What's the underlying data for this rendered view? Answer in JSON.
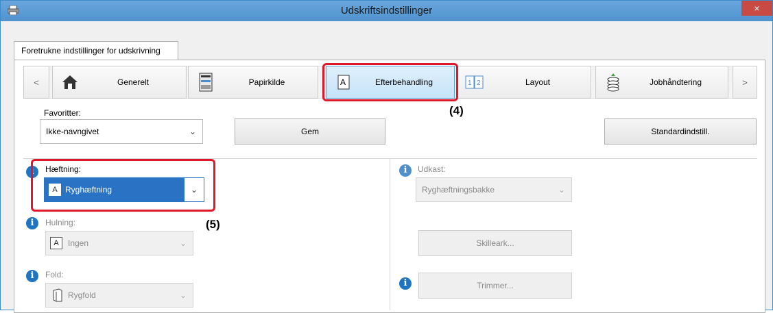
{
  "window": {
    "title": "Udskriftsindstillinger",
    "close_label": "×"
  },
  "tab": {
    "label": "Foretrukne indstillinger for udskrivning"
  },
  "nav": {
    "prev": "<",
    "next": ">",
    "items": [
      {
        "label": "Generelt",
        "icon": "home-icon"
      },
      {
        "label": "Papirkilde",
        "icon": "printer-tray-icon"
      },
      {
        "label": "Efterbehandling",
        "icon": "finishing-page-icon"
      },
      {
        "label": "Layout",
        "icon": "layout-pages-icon"
      },
      {
        "label": "Jobhåndtering",
        "icon": "job-stack-icon"
      }
    ]
  },
  "favorites": {
    "label": "Favoritter:",
    "value": "Ikke-navngivet",
    "save_label": "Gem",
    "defaults_label": "Standardindstill."
  },
  "stapling": {
    "label": "Hæftning:",
    "value": "Ryghæftning",
    "icon_glyph": "A"
  },
  "punch": {
    "label": "Hulning:",
    "value": "Ingen",
    "icon_glyph": "A"
  },
  "fold": {
    "label": "Fold:",
    "value": "Rygfold"
  },
  "output": {
    "label": "Udkast:",
    "value": "Ryghæftningsbakke"
  },
  "separator_button": "Skilleark...",
  "trimmer_button": "Trimmer...",
  "callouts": {
    "four": "(4)",
    "five": "(5)"
  },
  "info_glyph": "i",
  "colors": {
    "highlight": "#e0162b",
    "selected": "#2a73c4",
    "titlebar": "#5b9bd5"
  }
}
